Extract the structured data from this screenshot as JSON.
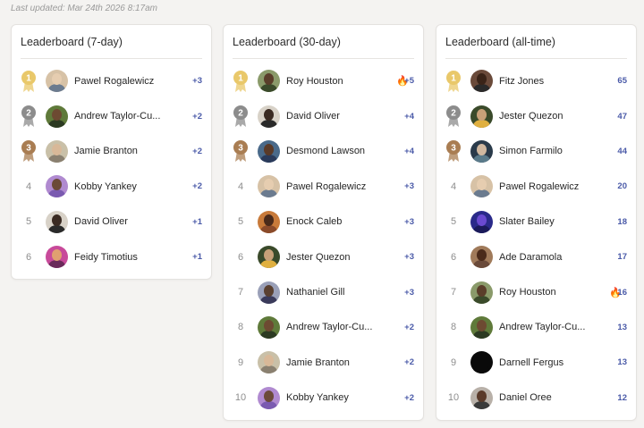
{
  "last_updated": "Last updated: Mar 24th 2026 8:17am",
  "colors": {
    "gold": "#e9c86a",
    "silver": "#8c8c8c",
    "bronze": "#a97d52",
    "score": "#4a5aa8"
  },
  "boards": [
    {
      "title": "Leaderboard (7-day)",
      "rows": [
        {
          "rank": "1",
          "name": "Pawel Rogalewicz",
          "score": "+3",
          "avatar": [
            "#d7c2a6",
            "#e6cdb0",
            "#6b7b8f"
          ]
        },
        {
          "rank": "2",
          "name": "Andrew Taylor-Cu...",
          "score": "+2",
          "avatar": [
            "#5f7a3a",
            "#6d4a32",
            "#2c3a22"
          ]
        },
        {
          "rank": "3",
          "name": "Jamie Branton",
          "score": "+2",
          "avatar": [
            "#c9c0a8",
            "#d8b898",
            "#8a8070"
          ]
        },
        {
          "rank": "4",
          "name": "Kobby Yankey",
          "score": "+2",
          "avatar": [
            "#b08ad0",
            "#6b4a38",
            "#7a5ab0"
          ]
        },
        {
          "rank": "5",
          "name": "David Oliver",
          "score": "+1",
          "avatar": [
            "#d8d2c8",
            "#3a2a22",
            "#2a2a2a"
          ]
        },
        {
          "rank": "6",
          "name": "Feidy Timotius",
          "score": "+1",
          "avatar": [
            "#c84a9a",
            "#e0a070",
            "#6a2a5a"
          ]
        }
      ]
    },
    {
      "title": "Leaderboard (30-day)",
      "rows": [
        {
          "rank": "1",
          "name": "Roy Houston",
          "fire": "🔥",
          "score": "+5",
          "avatar": [
            "#8a9a6a",
            "#5a3e2a",
            "#3a4a2a"
          ]
        },
        {
          "rank": "2",
          "name": "David Oliver",
          "score": "+4",
          "avatar": [
            "#d8d2c8",
            "#3a2a22",
            "#2a2a2a"
          ]
        },
        {
          "rank": "3",
          "name": "Desmond Lawson",
          "score": "+4",
          "avatar": [
            "#4a6a8a",
            "#5a3a28",
            "#2a3a5a"
          ]
        },
        {
          "rank": "4",
          "name": "Pawel Rogalewicz",
          "score": "+3",
          "avatar": [
            "#d7c2a6",
            "#e6cdb0",
            "#6b7b8f"
          ]
        },
        {
          "rank": "5",
          "name": "Enock Caleb",
          "score": "+3",
          "avatar": [
            "#c87a3a",
            "#4a2a1a",
            "#8a4a2a"
          ]
        },
        {
          "rank": "6",
          "name": "Jester Quezon",
          "score": "+3",
          "avatar": [
            "#3a4a2a",
            "#c8a078",
            "#e0b040"
          ]
        },
        {
          "rank": "7",
          "name": "Nathaniel Gill",
          "score": "+3",
          "avatar": [
            "#9aa0b8",
            "#5a4030",
            "#3a3a5a"
          ]
        },
        {
          "rank": "8",
          "name": "Andrew Taylor-Cu...",
          "score": "+2",
          "avatar": [
            "#5f7a3a",
            "#6d4a32",
            "#2c3a22"
          ]
        },
        {
          "rank": "9",
          "name": "Jamie Branton",
          "score": "+2",
          "avatar": [
            "#c9c0a8",
            "#d8b898",
            "#8a8070"
          ]
        },
        {
          "rank": "10",
          "name": "Kobby Yankey",
          "score": "+2",
          "avatar": [
            "#b08ad0",
            "#6b4a38",
            "#7a5ab0"
          ]
        }
      ]
    },
    {
      "title": "Leaderboard (all-time)",
      "rows": [
        {
          "rank": "1",
          "name": "Fitz Jones",
          "score": "65",
          "avatar": [
            "#6a4a3a",
            "#3a2418",
            "#2a2a2a"
          ]
        },
        {
          "rank": "2",
          "name": "Jester Quezon",
          "score": "47",
          "avatar": [
            "#3a4a2a",
            "#c8a078",
            "#e0b040"
          ]
        },
        {
          "rank": "3",
          "name": "Simon Farmilo",
          "score": "44",
          "avatar": [
            "#2a3a4a",
            "#d0b8a0",
            "#5a7a8a"
          ]
        },
        {
          "rank": "4",
          "name": "Pawel Rogalewicz",
          "score": "20",
          "avatar": [
            "#d7c2a6",
            "#e6cdb0",
            "#6b7b8f"
          ]
        },
        {
          "rank": "5",
          "name": "Slater Bailey",
          "score": "18",
          "avatar": [
            "#2a2a8a",
            "#6a4ad0",
            "#1a1a5a"
          ]
        },
        {
          "rank": "6",
          "name": "Ade Daramola",
          "score": "17",
          "avatar": [
            "#a07a5a",
            "#4a2a1a",
            "#6a4a3a"
          ]
        },
        {
          "rank": "7",
          "name": "Roy Houston",
          "fire": "🔥",
          "score": "16",
          "avatar": [
            "#8a9a6a",
            "#5a3e2a",
            "#3a4a2a"
          ]
        },
        {
          "rank": "8",
          "name": "Andrew Taylor-Cu...",
          "score": "13",
          "avatar": [
            "#5f7a3a",
            "#6d4a32",
            "#2c3a22"
          ]
        },
        {
          "rank": "9",
          "name": "Darnell Fergus",
          "score": "13",
          "avatar": [
            "#0a0a0a",
            "#0a0a0a",
            "#0a0a0a"
          ]
        },
        {
          "rank": "10",
          "name": "Daniel Oree",
          "score": "12",
          "avatar": [
            "#b8b0a8",
            "#5a3a2a",
            "#3a3a3a"
          ]
        }
      ]
    }
  ]
}
